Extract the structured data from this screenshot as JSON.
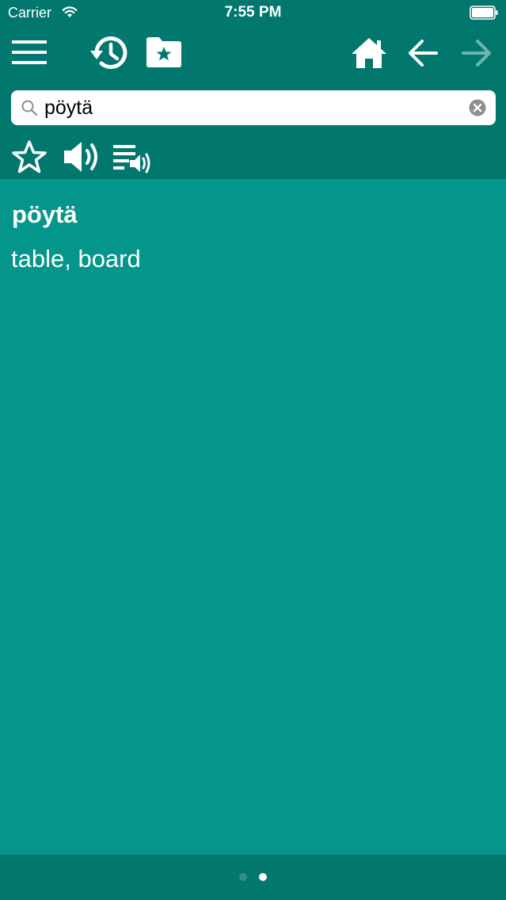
{
  "status_bar": {
    "carrier": "Carrier",
    "time": "7:55 PM"
  },
  "toolbar": {
    "icons": [
      "menu-icon",
      "history-icon",
      "favorites-folder-icon",
      "home-icon",
      "back-arrow-icon",
      "forward-arrow-icon"
    ]
  },
  "search": {
    "value": "pöytä",
    "placeholder": ""
  },
  "action_icons": [
    "star-icon",
    "speaker-icon",
    "playlist-audio-icon"
  ],
  "entry": {
    "headword": "pöytä",
    "translation": "table, board"
  },
  "pager": {
    "pages": 2,
    "current": 2
  },
  "colors": {
    "header": "#02776e",
    "content": "#04968a",
    "text": "#ffffff",
    "disabled_icon": "#6ab7b0"
  }
}
